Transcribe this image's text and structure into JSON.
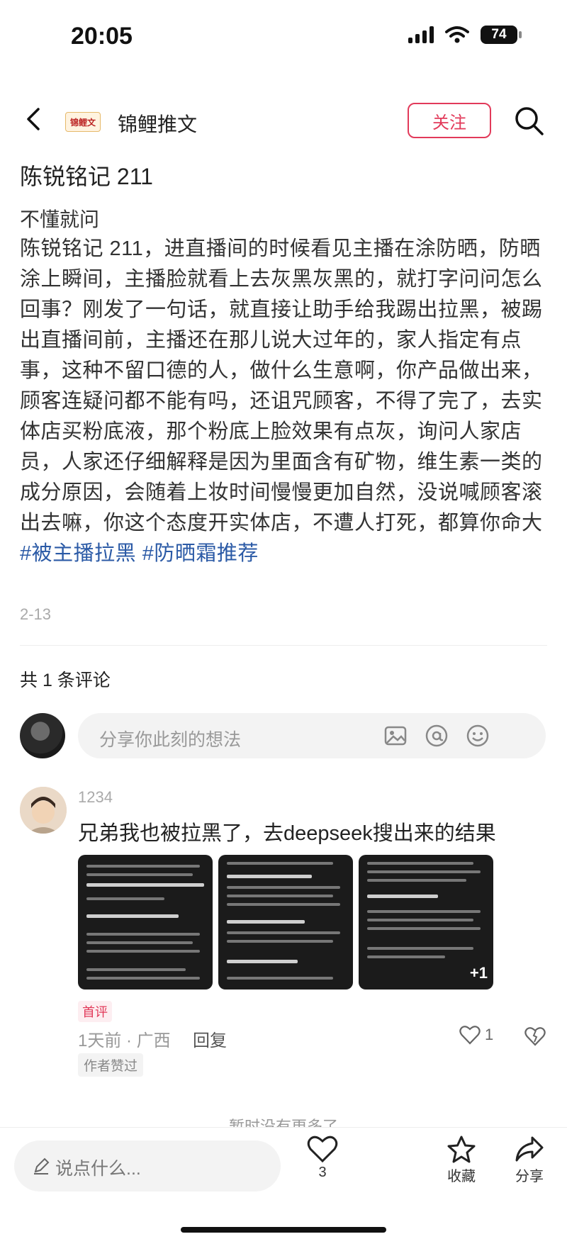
{
  "status_bar": {
    "time": "20:05",
    "battery": "74"
  },
  "header": {
    "account_logo": "锦鲤文",
    "account_name": "锦鲤推文",
    "follow_label": "关注"
  },
  "post": {
    "title": "陈锐铭记 211",
    "subtitle": "不懂就问",
    "body": "陈锐铭记 211，进直播间的时候看见主播在涂防晒，防晒涂上瞬间，主播脸就看上去灰黑灰黑的，就打字问问怎么回事？刚发了一句话，就直接让助手给我踢出拉黑，被踢出直播间前，主播还在那儿说大过年的，家人指定有点事，这种不留口德的人，做什么生意啊，你产品做出来，顾客连疑问都不能有吗，还诅咒顾客，不得了完了，去实体店买粉底液，那个粉底上脸效果有点灰，询问人家店员，人家还仔细解释是因为里面含有矿物，维生素一类的成分原因，会随着上妆时间慢慢更加自然，没说喊顾客滚出去嘛，你这个态度开实体店，不遭人打死，都算你命大",
    "tags": [
      "#被主播拉黑",
      "#防晒霜推荐"
    ],
    "date": "2-13"
  },
  "comments_section": {
    "count_label": "共 1 条评论",
    "input_placeholder": "分享你此刻的想法"
  },
  "comment": {
    "user": "1234",
    "text": "兄弟我也被拉黑了，去deepseek搜出来的结果",
    "images_more": "+1",
    "badge": "首评",
    "meta": "1天前 · 广西",
    "reply_label": "回复",
    "author_liked": "作者赞过",
    "likes": "1"
  },
  "no_more": "暂时没有更多了",
  "bottom_bar": {
    "say_placeholder": "说点什么...",
    "like_count": "3",
    "collect_label": "收藏",
    "share_label": "分享"
  },
  "colors": {
    "accent": "#e23a5a",
    "tag": "#2b5aa6"
  },
  "icons": [
    "back-icon",
    "search-icon",
    "image-icon",
    "at-icon",
    "emoji-icon",
    "heart-icon",
    "dislike-icon",
    "pen-icon",
    "star-icon",
    "share-icon"
  ]
}
